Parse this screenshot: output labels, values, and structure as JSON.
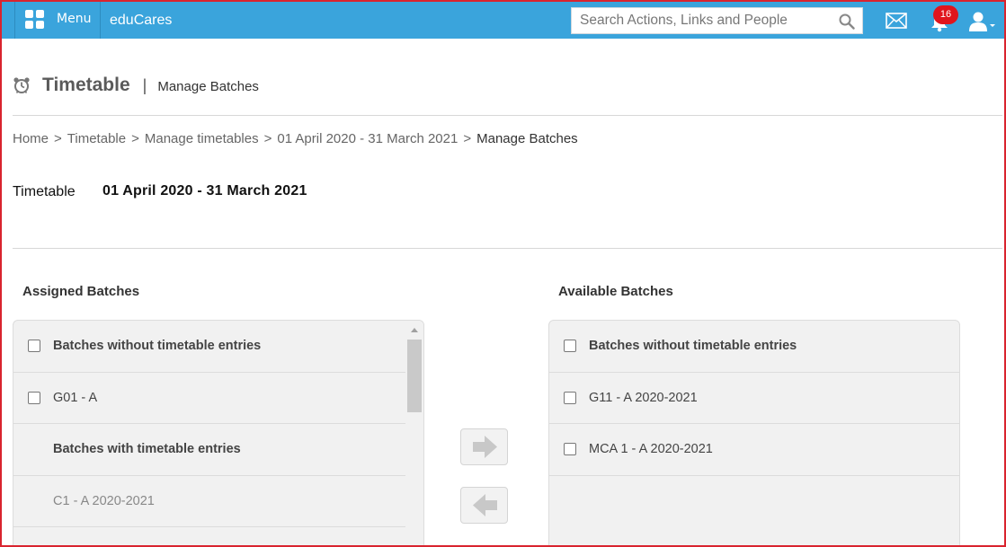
{
  "topbar": {
    "menu_label": "Menu",
    "brand": "eduCares",
    "search_placeholder": "Search Actions, Links and People",
    "notification_count": "16",
    "color": "#3aa4dc"
  },
  "header": {
    "title": "Timetable",
    "separator": "|",
    "subtitle": "Manage Batches"
  },
  "breadcrumb": {
    "items": [
      "Home",
      "Timetable",
      "Manage timetables",
      "01 April 2020 - 31 March 2021"
    ],
    "separator": ">",
    "current": "Manage Batches"
  },
  "timetable": {
    "label": "Timetable",
    "value": "01 April 2020 - 31 March 2021"
  },
  "assigned": {
    "title": "Assigned Batches",
    "rows": [
      {
        "kind": "header",
        "label": "Batches without timetable entries",
        "checkbox": true
      },
      {
        "kind": "item",
        "label": "G01 - A",
        "checkbox": true
      },
      {
        "kind": "header",
        "label": "Batches with timetable entries",
        "checkbox": false
      },
      {
        "kind": "disabled",
        "label": "C1 - A 2020-2021",
        "checkbox": false
      }
    ]
  },
  "available": {
    "title": "Available Batches",
    "rows": [
      {
        "kind": "header",
        "label": "Batches without timetable entries",
        "checkbox": true
      },
      {
        "kind": "item",
        "label": "G11 - A 2020-2021",
        "checkbox": true
      },
      {
        "kind": "item",
        "label": "MCA 1 - A 2020-2021",
        "checkbox": true
      }
    ]
  },
  "icons": {
    "menu": "grid-icon",
    "search": "search-icon",
    "mail": "mail-icon",
    "notifications": "bell-icon",
    "user": "user-icon",
    "page": "alarm-clock-icon",
    "move_right": "arrow-right-icon",
    "move_left": "arrow-left-icon"
  }
}
